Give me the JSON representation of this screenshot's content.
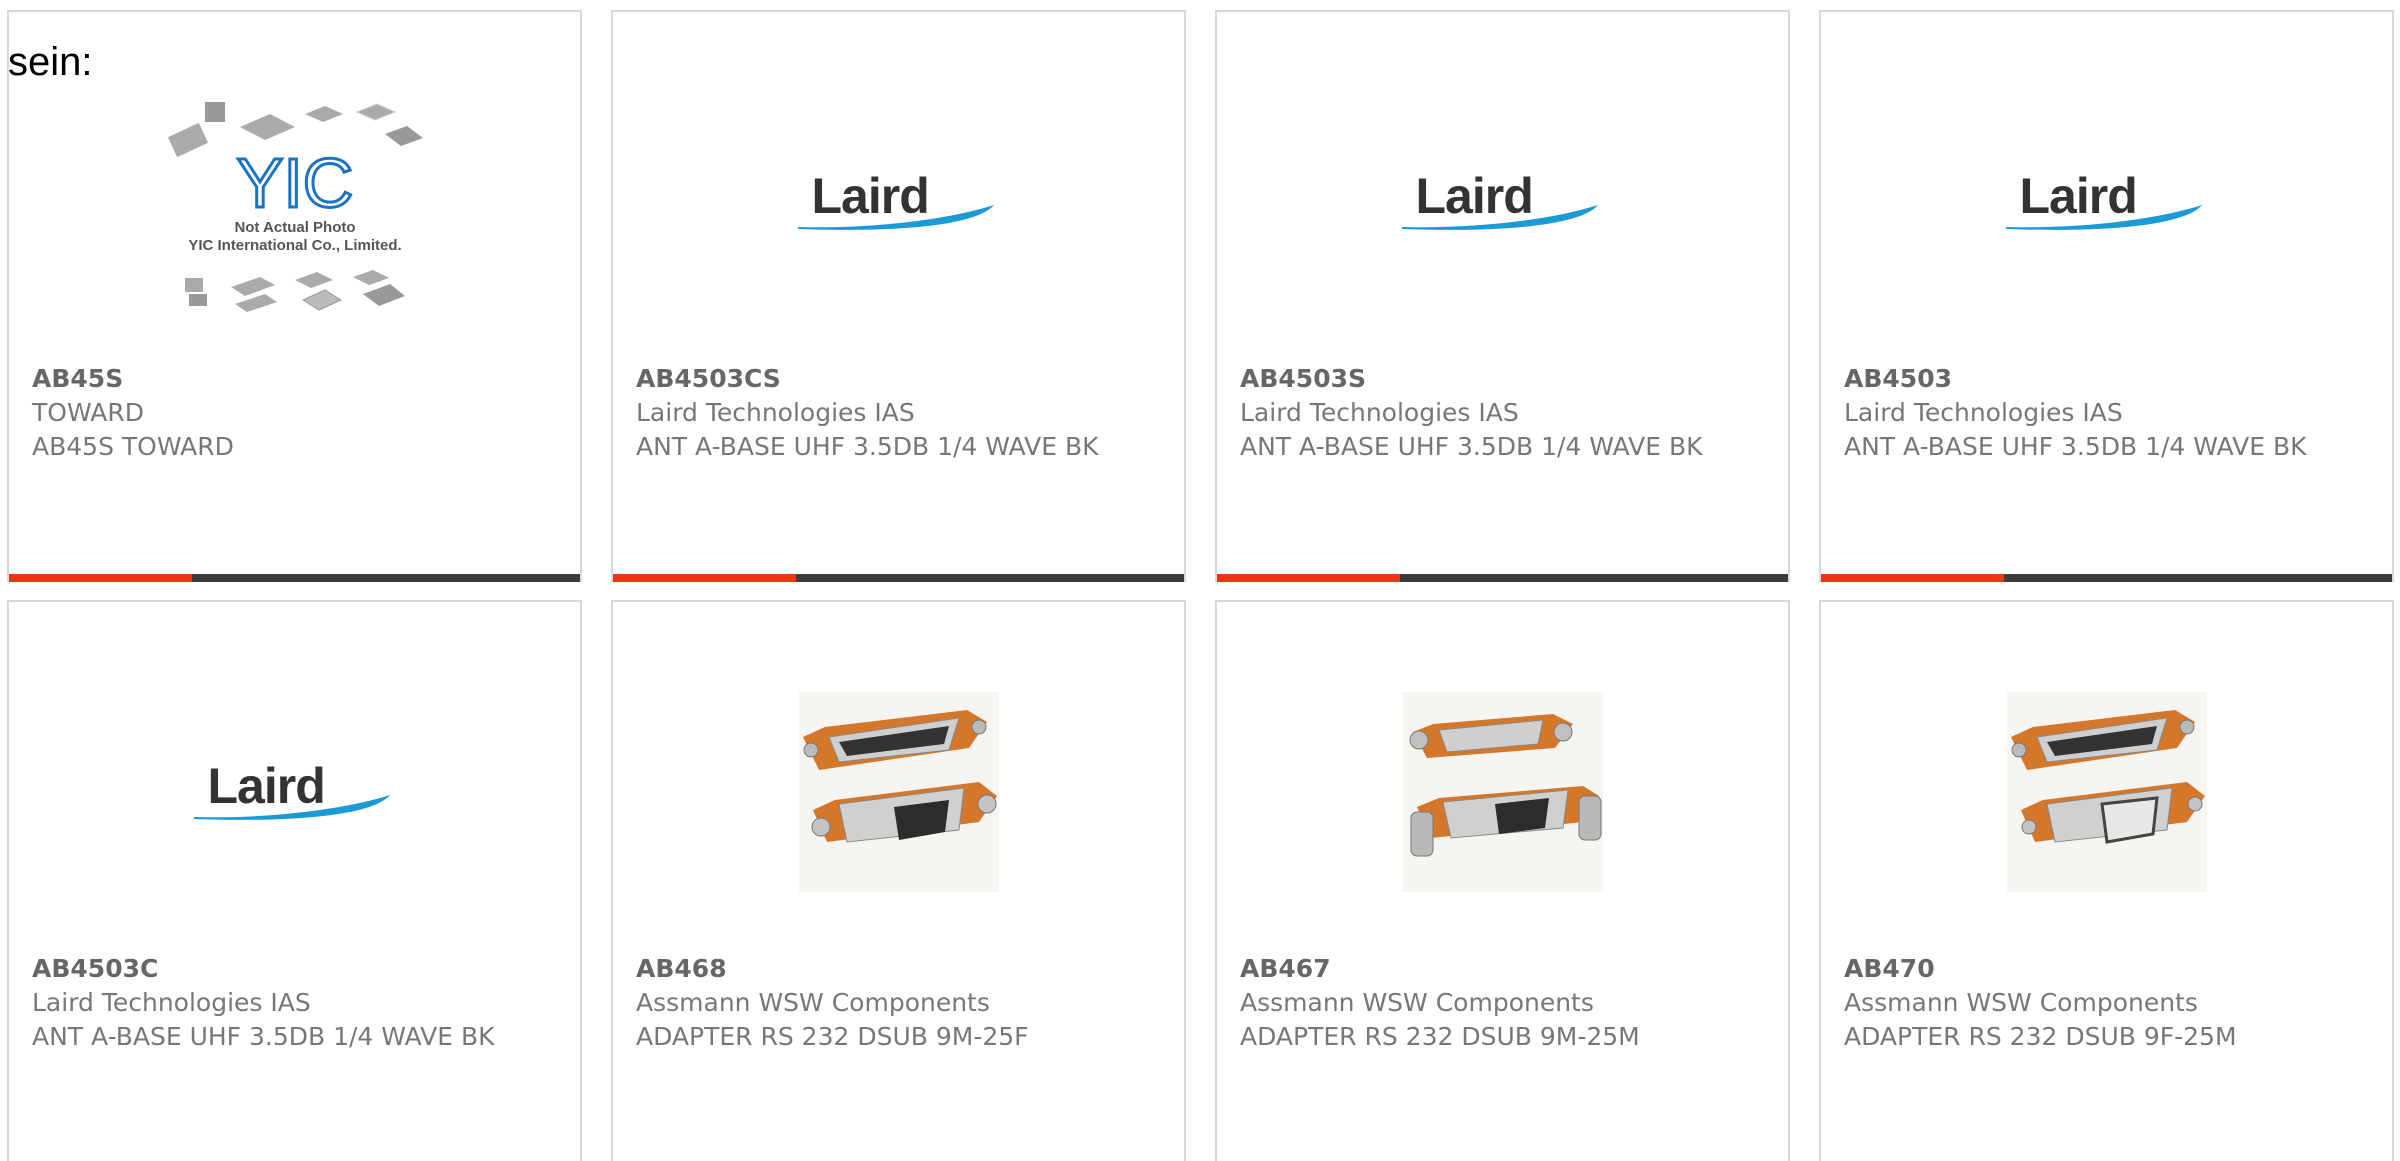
{
  "stray_text": "sein:",
  "colors": {
    "accent_bar": "#e23b12",
    "dark_bar": "#3b3b3b",
    "laird_blue": "#1a9ad6"
  },
  "products": [
    {
      "part_number": "AB45S",
      "manufacturer": "TOWARD",
      "description": "AB45S TOWARD",
      "image": "placeholder-chips-icon",
      "image_caption_1": "Not Actual Photo",
      "image_caption_2": "YIC International Co., Limited.",
      "image_logo": "YIC"
    },
    {
      "part_number": "AB4503CS",
      "manufacturer": "Laird Technologies IAS",
      "description": "ANT A-BASE UHF 3.5DB 1/4 WAVE BK",
      "image": "laird-logo-icon",
      "image_logo": "Laird"
    },
    {
      "part_number": "AB4503S",
      "manufacturer": "Laird Technologies IAS",
      "description": "ANT A-BASE UHF 3.5DB 1/4 WAVE BK",
      "image": "laird-logo-icon",
      "image_logo": "Laird"
    },
    {
      "part_number": "AB4503",
      "manufacturer": "Laird Technologies IAS",
      "description": "ANT A-BASE UHF 3.5DB 1/4 WAVE BK",
      "image": "laird-logo-icon",
      "image_logo": "Laird"
    },
    {
      "part_number": "AB4503C",
      "manufacturer": "Laird Technologies IAS",
      "description": "ANT A-BASE UHF 3.5DB 1/4 WAVE BK",
      "image": "laird-logo-icon",
      "image_logo": "Laird"
    },
    {
      "part_number": "AB468",
      "manufacturer": "Assmann WSW Components",
      "description": "ADAPTER RS 232 DSUB 9M-25F",
      "image": "dsub-adapter-icon"
    },
    {
      "part_number": "AB467",
      "manufacturer": "Assmann WSW Components",
      "description": "ADAPTER RS 232 DSUB 9M-25M",
      "image": "dsub-adapter-icon"
    },
    {
      "part_number": "AB470",
      "manufacturer": "Assmann WSW Components",
      "description": "ADAPTER RS 232 DSUB 9F-25M",
      "image": "dsub-adapter-icon"
    }
  ]
}
